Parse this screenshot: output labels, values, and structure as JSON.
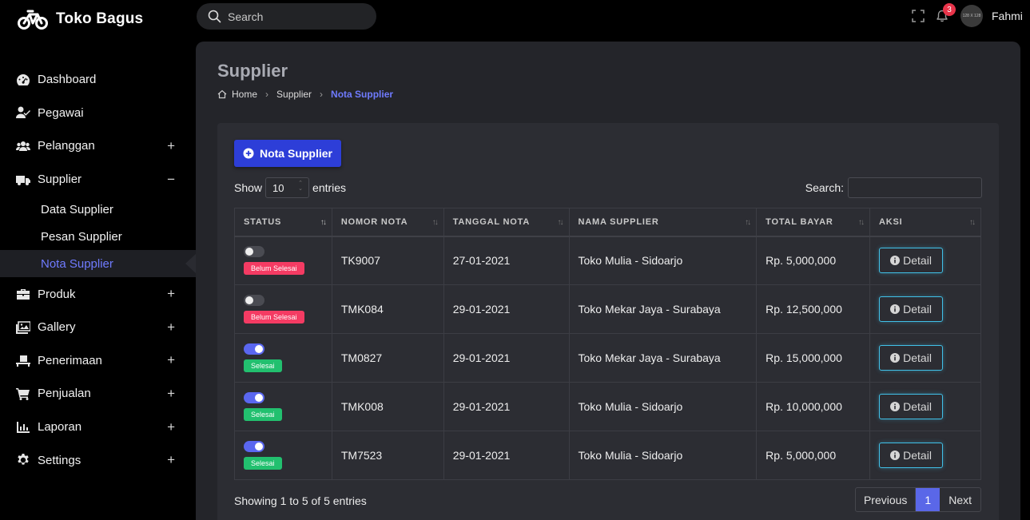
{
  "brand": {
    "name": "Toko Bagus"
  },
  "topbar": {
    "search_placeholder": "Search",
    "notification_count": "3",
    "avatar_text": "128 X 128",
    "username": "Fahmi"
  },
  "sidebar": {
    "items": [
      {
        "label": "Dashboard",
        "icon": "dashboard-icon",
        "toggle": ""
      },
      {
        "label": "Pegawai",
        "icon": "user-check-icon",
        "toggle": ""
      },
      {
        "label": "Pelanggan",
        "icon": "users-icon",
        "toggle": "+"
      },
      {
        "label": "Supplier",
        "icon": "truck-icon",
        "toggle": "−"
      },
      {
        "label": "Produk",
        "icon": "briefcase-icon",
        "toggle": "+"
      },
      {
        "label": "Gallery",
        "icon": "images-icon",
        "toggle": "+"
      },
      {
        "label": "Penerimaan",
        "icon": "dolly-icon",
        "toggle": "+"
      },
      {
        "label": "Penjualan",
        "icon": "cart-icon",
        "toggle": "+"
      },
      {
        "label": "Laporan",
        "icon": "chart-icon",
        "toggle": "+"
      },
      {
        "label": "Settings",
        "icon": "gear-icon",
        "toggle": "+"
      }
    ],
    "supplier_sub": [
      "Data Supplier",
      "Pesan Supplier",
      "Nota Supplier"
    ]
  },
  "page": {
    "title": "Supplier",
    "breadcrumb": [
      "Home",
      "Supplier",
      "Nota Supplier"
    ]
  },
  "toolbar": {
    "add_button": "Nota Supplier",
    "show_label": "Show",
    "entries_value": "10",
    "entries_label": "entries",
    "search_label": "Search:"
  },
  "table": {
    "columns": [
      "STATUS",
      "NOMOR NOTA",
      "TANGGAL NOTA",
      "NAMA SUPPLIER",
      "TOTAL BAYAR",
      "AKSI"
    ],
    "rows": [
      {
        "done": false,
        "status": "Belum Selesai",
        "nomor": "TK9007",
        "tanggal": "27-01-2021",
        "supplier": "Toko Mulia - Sidoarjo",
        "total": "Rp. 5,000,000",
        "aksi": "Detail"
      },
      {
        "done": false,
        "status": "Belum Selesai",
        "nomor": "TMK084",
        "tanggal": "29-01-2021",
        "supplier": "Toko Mekar Jaya - Surabaya",
        "total": "Rp. 12,500,000",
        "aksi": "Detail"
      },
      {
        "done": true,
        "status": "Selesai",
        "nomor": "TM0827",
        "tanggal": "29-01-2021",
        "supplier": "Toko Mekar Jaya - Surabaya",
        "total": "Rp. 15,000,000",
        "aksi": "Detail"
      },
      {
        "done": true,
        "status": "Selesai",
        "nomor": "TMK008",
        "tanggal": "29-01-2021",
        "supplier": "Toko Mulia - Sidoarjo",
        "total": "Rp. 10,000,000",
        "aksi": "Detail"
      },
      {
        "done": true,
        "status": "Selesai",
        "nomor": "TM7523",
        "tanggal": "29-01-2021",
        "supplier": "Toko Mulia - Sidoarjo",
        "total": "Rp. 5,000,000",
        "aksi": "Detail"
      }
    ]
  },
  "footer": {
    "info": "Showing 1 to 5 of 5 entries",
    "previous": "Previous",
    "page": "1",
    "next": "Next"
  },
  "colors": {
    "accent": "#6f7bff",
    "primary_button": "#2d3ed8",
    "danger": "#f43b63",
    "success": "#22c06f",
    "detail_border": "#41c1e8"
  }
}
